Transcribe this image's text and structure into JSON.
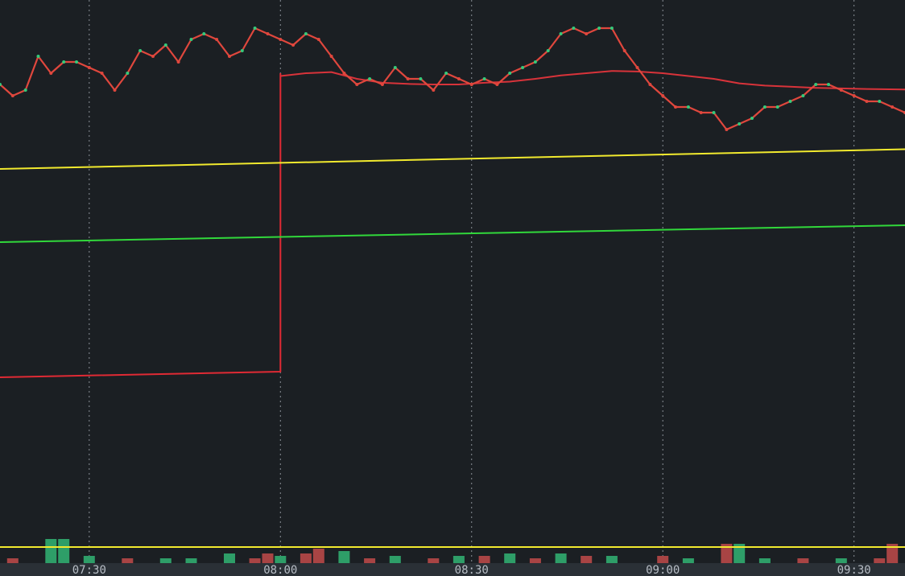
{
  "theme": {
    "background": "#1b1f23",
    "grid_color": "#8a9097",
    "axis_bar_color": "#2a3036",
    "price_color": "#e0473d",
    "price_dot_up": "#35c97a",
    "ma_color": "#d8333a",
    "yellow_line": "#f2ea2e",
    "green_line": "#31d83b",
    "red_line": "#e02a34",
    "volume_up": "#2e9e68",
    "volume_down": "#a84444",
    "volume_ref_line": "#f2ea2e"
  },
  "chart_data": {
    "type": "line",
    "x_axis": {
      "unit": "time",
      "range": [
        "07:16",
        "09:38"
      ],
      "ticks": [
        "07:30",
        "08:00",
        "08:30",
        "09:00",
        "09:30"
      ],
      "grid": "vertical-dotted"
    },
    "y_axis": {
      "range": [
        0,
        100
      ],
      "labels": "none",
      "grid": false
    },
    "series": [
      {
        "role": "price",
        "points": [
          [
            "07:16",
            85
          ],
          [
            "07:18",
            83
          ],
          [
            "07:20",
            84
          ],
          [
            "07:22",
            90
          ],
          [
            "07:24",
            87
          ],
          [
            "07:26",
            89
          ],
          [
            "07:28",
            89
          ],
          [
            "07:30",
            88
          ],
          [
            "07:32",
            87
          ],
          [
            "07:34",
            84
          ],
          [
            "07:36",
            87
          ],
          [
            "07:38",
            91
          ],
          [
            "07:40",
            90
          ],
          [
            "07:42",
            92
          ],
          [
            "07:44",
            89
          ],
          [
            "07:46",
            93
          ],
          [
            "07:48",
            94
          ],
          [
            "07:50",
            93
          ],
          [
            "07:52",
            90
          ],
          [
            "07:54",
            91
          ],
          [
            "07:56",
            95
          ],
          [
            "07:58",
            94
          ],
          [
            "08:00",
            93
          ],
          [
            "08:02",
            92
          ],
          [
            "08:04",
            94
          ],
          [
            "08:06",
            93
          ],
          [
            "08:08",
            90
          ],
          [
            "08:10",
            87
          ],
          [
            "08:12",
            85
          ],
          [
            "08:14",
            86
          ],
          [
            "08:16",
            85
          ],
          [
            "08:18",
            88
          ],
          [
            "08:20",
            86
          ],
          [
            "08:22",
            86
          ],
          [
            "08:24",
            84
          ],
          [
            "08:26",
            87
          ],
          [
            "08:28",
            86
          ],
          [
            "08:30",
            85
          ],
          [
            "08:32",
            86
          ],
          [
            "08:34",
            85
          ],
          [
            "08:36",
            87
          ],
          [
            "08:38",
            88
          ],
          [
            "08:40",
            89
          ],
          [
            "08:42",
            91
          ],
          [
            "08:44",
            94
          ],
          [
            "08:46",
            95
          ],
          [
            "08:48",
            94
          ],
          [
            "08:50",
            95
          ],
          [
            "08:52",
            95
          ],
          [
            "08:54",
            91
          ],
          [
            "08:56",
            88
          ],
          [
            "08:58",
            85
          ],
          [
            "09:00",
            83
          ],
          [
            "09:02",
            81
          ],
          [
            "09:04",
            81
          ],
          [
            "09:06",
            80
          ],
          [
            "09:08",
            80
          ],
          [
            "09:10",
            77
          ],
          [
            "09:12",
            78
          ],
          [
            "09:14",
            79
          ],
          [
            "09:16",
            81
          ],
          [
            "09:18",
            81
          ],
          [
            "09:20",
            82
          ],
          [
            "09:22",
            83
          ],
          [
            "09:24",
            85
          ],
          [
            "09:26",
            85
          ],
          [
            "09:28",
            84
          ],
          [
            "09:30",
            83
          ],
          [
            "09:32",
            82
          ],
          [
            "09:34",
            82
          ],
          [
            "09:36",
            81
          ],
          [
            "09:38",
            80
          ]
        ]
      },
      {
        "role": "moving-average",
        "points": [
          [
            "08:00",
            86.5
          ],
          [
            "08:04",
            87
          ],
          [
            "08:08",
            87.2
          ],
          [
            "08:12",
            86
          ],
          [
            "08:16",
            85.3
          ],
          [
            "08:20",
            85.1
          ],
          [
            "08:24",
            85
          ],
          [
            "08:28",
            85
          ],
          [
            "08:32",
            85.3
          ],
          [
            "08:36",
            85.5
          ],
          [
            "08:40",
            86
          ],
          [
            "08:44",
            86.6
          ],
          [
            "08:48",
            87
          ],
          [
            "08:52",
            87.4
          ],
          [
            "08:56",
            87.3
          ],
          [
            "09:00",
            87
          ],
          [
            "09:04",
            86.5
          ],
          [
            "09:08",
            86
          ],
          [
            "09:12",
            85.2
          ],
          [
            "09:16",
            84.8
          ],
          [
            "09:20",
            84.6
          ],
          [
            "09:24",
            84.4
          ],
          [
            "09:28",
            84.3
          ],
          [
            "09:32",
            84.2
          ],
          [
            "09:38",
            84.1
          ]
        ]
      },
      {
        "role": "yellow-line",
        "points": [
          [
            "07:16",
            70
          ],
          [
            "09:38",
            73.5
          ]
        ]
      },
      {
        "role": "green-line",
        "points": [
          [
            "07:16",
            57
          ],
          [
            "09:38",
            60
          ]
        ]
      },
      {
        "role": "red-line",
        "points": [
          [
            "07:16",
            33
          ],
          [
            "08:00",
            34
          ],
          [
            "08:00",
            87
          ]
        ]
      }
    ],
    "volume": {
      "type": "bar",
      "reference_line": true,
      "bars": [
        {
          "t": "07:18",
          "v": 0.2,
          "dir": "down"
        },
        {
          "t": "07:24",
          "v": 1.0,
          "dir": "up"
        },
        {
          "t": "07:26",
          "v": 1.0,
          "dir": "up"
        },
        {
          "t": "07:30",
          "v": 0.3,
          "dir": "up"
        },
        {
          "t": "07:36",
          "v": 0.2,
          "dir": "down"
        },
        {
          "t": "07:42",
          "v": 0.2,
          "dir": "up"
        },
        {
          "t": "07:46",
          "v": 0.2,
          "dir": "up"
        },
        {
          "t": "07:52",
          "v": 0.4,
          "dir": "up"
        },
        {
          "t": "07:56",
          "v": 0.2,
          "dir": "down"
        },
        {
          "t": "07:58",
          "v": 0.4,
          "dir": "down"
        },
        {
          "t": "08:00",
          "v": 0.3,
          "dir": "up"
        },
        {
          "t": "08:04",
          "v": 0.4,
          "dir": "down"
        },
        {
          "t": "08:06",
          "v": 0.6,
          "dir": "down"
        },
        {
          "t": "08:10",
          "v": 0.5,
          "dir": "up"
        },
        {
          "t": "08:14",
          "v": 0.2,
          "dir": "down"
        },
        {
          "t": "08:18",
          "v": 0.3,
          "dir": "up"
        },
        {
          "t": "08:24",
          "v": 0.2,
          "dir": "down"
        },
        {
          "t": "08:28",
          "v": 0.3,
          "dir": "up"
        },
        {
          "t": "08:32",
          "v": 0.3,
          "dir": "down"
        },
        {
          "t": "08:36",
          "v": 0.4,
          "dir": "up"
        },
        {
          "t": "08:40",
          "v": 0.2,
          "dir": "down"
        },
        {
          "t": "08:44",
          "v": 0.4,
          "dir": "up"
        },
        {
          "t": "08:48",
          "v": 0.3,
          "dir": "down"
        },
        {
          "t": "08:52",
          "v": 0.3,
          "dir": "up"
        },
        {
          "t": "09:00",
          "v": 0.3,
          "dir": "down"
        },
        {
          "t": "09:04",
          "v": 0.2,
          "dir": "up"
        },
        {
          "t": "09:10",
          "v": 0.8,
          "dir": "down"
        },
        {
          "t": "09:12",
          "v": 0.8,
          "dir": "up"
        },
        {
          "t": "09:16",
          "v": 0.2,
          "dir": "up"
        },
        {
          "t": "09:22",
          "v": 0.2,
          "dir": "down"
        },
        {
          "t": "09:28",
          "v": 0.2,
          "dir": "up"
        },
        {
          "t": "09:34",
          "v": 0.2,
          "dir": "down"
        },
        {
          "t": "09:36",
          "v": 0.8,
          "dir": "down"
        }
      ]
    }
  }
}
